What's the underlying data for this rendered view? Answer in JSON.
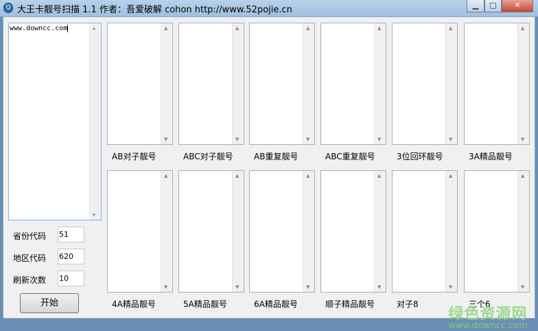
{
  "window": {
    "title": "大王卡靓号扫描 1.1  作者：吾爱破解 cohon   http://www.52pojie.cn",
    "minimize": "▁",
    "maximize": "□",
    "close": "✕"
  },
  "input_area": {
    "value": "www.downcc.com"
  },
  "fields": [
    {
      "label": "省份代码",
      "value": "51"
    },
    {
      "label": "地区代码",
      "value": "620"
    },
    {
      "label": "刷新次数",
      "value": "10"
    }
  ],
  "start_button": "开始",
  "result_boxes": [
    {
      "label": "AB对子靓号"
    },
    {
      "label": "ABC对子靓号"
    },
    {
      "label": "AB重复靓号"
    },
    {
      "label": "ABC重复靓号"
    },
    {
      "label": "3位回环靓号"
    },
    {
      "label": "3A精品靓号"
    },
    {
      "label": "4A精品靓号"
    },
    {
      "label": "5A精品靓号"
    },
    {
      "label": "6A精品靓号"
    },
    {
      "label": "顺子精品靓号"
    },
    {
      "label": "对子8"
    },
    {
      "label": "三个6"
    }
  ],
  "watermark": {
    "name": "绿色资源网",
    "url": "www.downcc.com"
  }
}
